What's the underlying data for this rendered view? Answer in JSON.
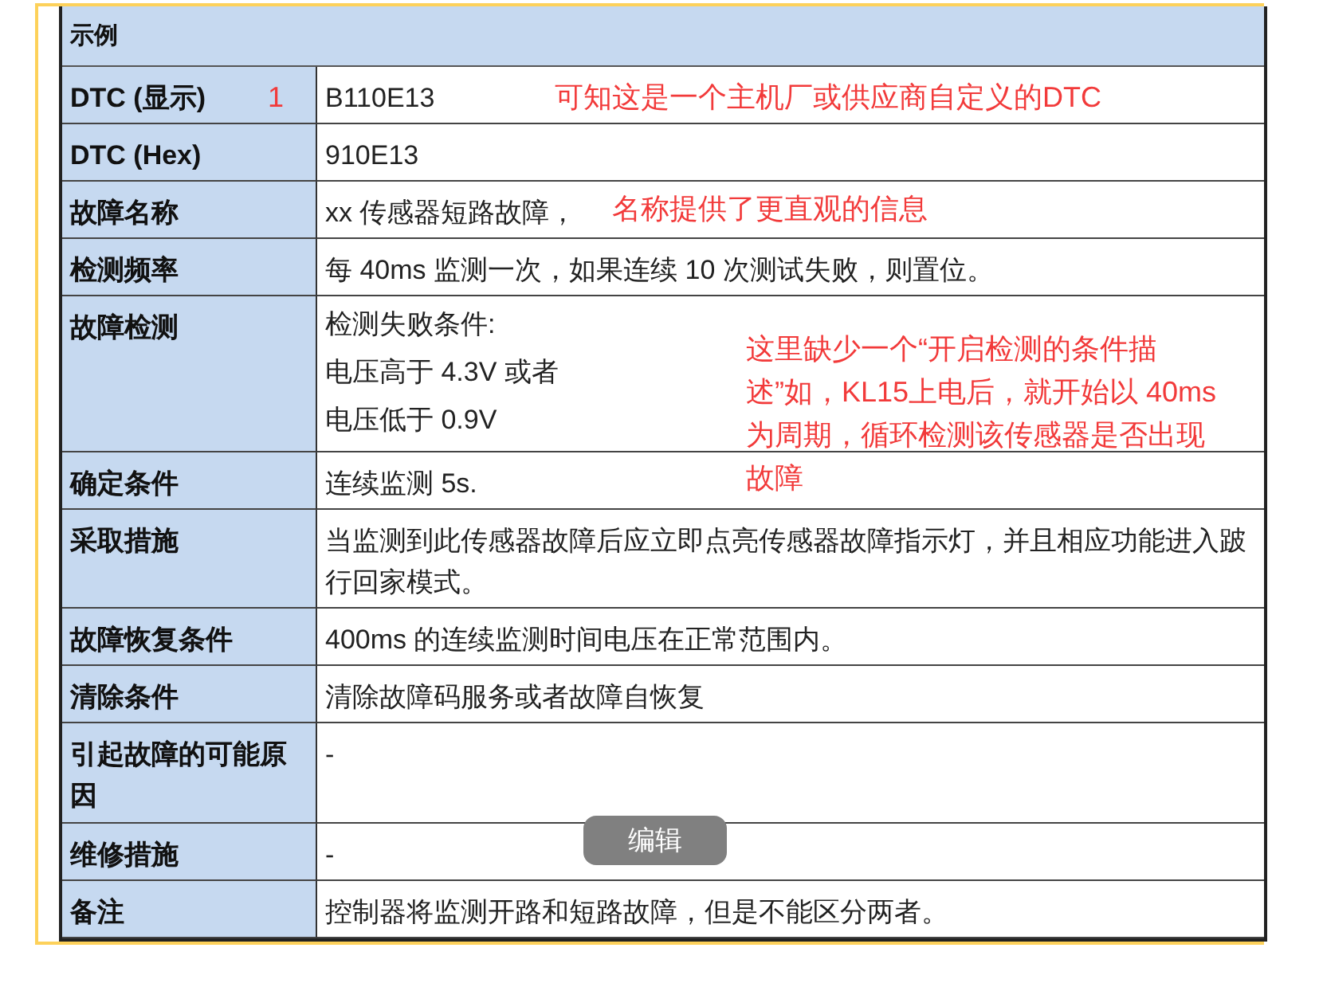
{
  "table": {
    "header": "示例",
    "rows": [
      {
        "label": "DTC (显示)",
        "lines": [
          "B110E13"
        ]
      },
      {
        "label": "DTC (Hex)",
        "lines": [
          "910E13"
        ]
      },
      {
        "label": "故障名称",
        "lines": [
          "xx 传感器短路故障，"
        ]
      },
      {
        "label": "检测频率",
        "lines": [
          "每 40ms 监测一次，如果连续 10 次测试失败，则置位。"
        ]
      },
      {
        "label": "故障检测",
        "lines": [
          "检测失败条件:",
          "电压高于 4.3V 或者",
          "电压低于 0.9V"
        ]
      },
      {
        "label": "确定条件",
        "lines": [
          "连续监测 5s."
        ]
      },
      {
        "label": "采取措施",
        "lines": [
          "当监测到此传感器故障后应立即点亮传感器故障指示灯，并且相应功能进入跛行回家模式。"
        ]
      },
      {
        "label": "故障恢复条件",
        "lines": [
          "400ms 的连续监测时间电压在正常范围内。"
        ]
      },
      {
        "label": "清除条件",
        "lines": [
          "清除故障码服务或者故障自恢复"
        ]
      },
      {
        "label": "引起故障的可能原因",
        "lines": [
          "-"
        ]
      },
      {
        "label": "维修措施",
        "lines": [
          "-"
        ]
      },
      {
        "label": "备注",
        "lines": [
          "控制器将监测开路和短路故障，但是不能区分两者。"
        ]
      }
    ]
  },
  "annotations": [
    {
      "text": "1"
    },
    {
      "text": "可知这是一个主机厂或供应商自定义的DTC"
    },
    {
      "text": "名称提供了更直观的信息"
    },
    {
      "text": "这里缺少一个“开启检测的条件描述”如，KL15上电后，就开始以 40ms 为周期，循环检测该传感器是否出现故障"
    }
  ],
  "edit_button": {
    "label": "编辑"
  }
}
